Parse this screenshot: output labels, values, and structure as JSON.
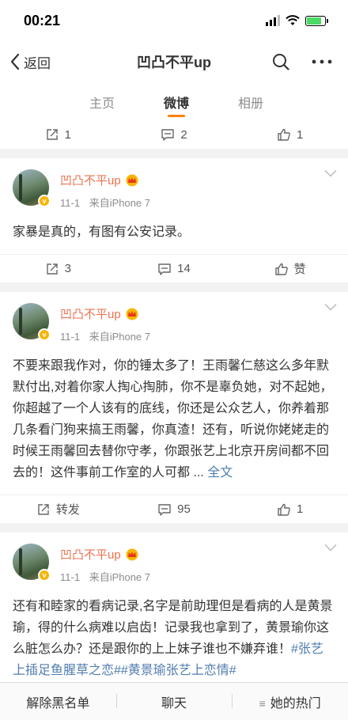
{
  "status_bar": {
    "time": "00:21"
  },
  "nav": {
    "back_label": "返回",
    "title": "凹凸不平up"
  },
  "tabs": [
    {
      "label": "主页",
      "active": false
    },
    {
      "label": "微博",
      "active": true
    },
    {
      "label": "相册",
      "active": false
    }
  ],
  "top_actions": {
    "repost": "1",
    "comment": "2",
    "like": "1"
  },
  "posts": [
    {
      "user": "凹凸不平up",
      "date": "11-1",
      "source": "来自iPhone 7",
      "text": "家暴是真的，有图有公安记录。",
      "repost": "3",
      "comment": "14",
      "like": "赞"
    },
    {
      "user": "凹凸不平up",
      "date": "11-1",
      "source": "来自iPhone 7",
      "text": "不要来跟我作对，你的锤太多了！王雨馨仁慈这么多年默默付出,对着你家人掏心掏肺，你不是辜负她，对不起她，你超越了一个人该有的底线，你还是公众艺人，你养着那几条看门狗来搞王雨馨，你真渣！还有，听说你姥姥走的时候王雨馨回去替你守孝，你跟张艺上北京开房间都不回去的！这件事前工作室的人可都 ...",
      "more_label": "全文",
      "repost": "转发",
      "comment": "95",
      "like": "1"
    },
    {
      "user": "凹凸不平up",
      "date": "11-1",
      "source": "来自iPhone 7",
      "text": "还有和睦家的看病记录,名字是前助理但是看病的人是黄景瑜，得的什么病难以启齿！记录我也拿到了，黄景瑜你这么脏怎么办？还是跟你的上上妹子谁也不嫌弃谁！",
      "hashtags": "#张艺上插足鱼腥草之恋##黄景瑜张艺上恋情#"
    }
  ],
  "bottom_bar": {
    "unblock": "解除黑名单",
    "chat": "聊天",
    "hot": "她的热门"
  },
  "colors": {
    "accent": "#ff8200",
    "username": "#eb7350",
    "link": "#507daf",
    "verified": "#f7b500"
  }
}
